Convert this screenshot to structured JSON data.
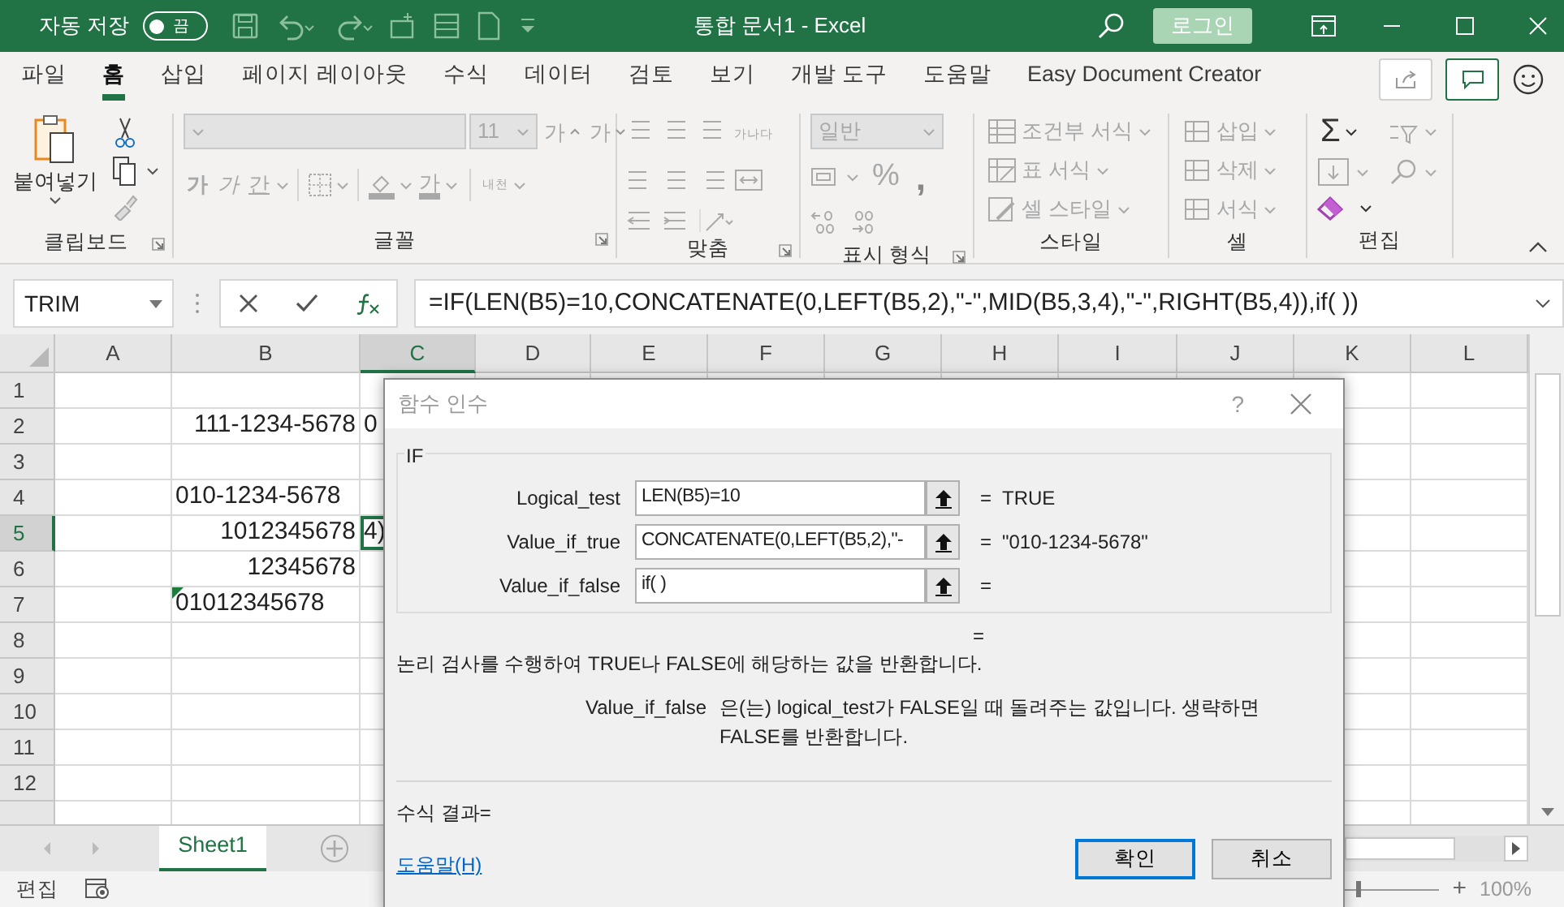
{
  "title_bar": {
    "autosave_label": "자동 저장",
    "autosave_toggle": {
      "text": "끔",
      "on": false
    },
    "title": "통합 문서1  -  Excel",
    "login": "로그인"
  },
  "menu_tabs": [
    {
      "label": "파일",
      "selected": false
    },
    {
      "label": "홈",
      "selected": true
    },
    {
      "label": "삽입",
      "selected": false
    },
    {
      "label": "페이지 레이아웃",
      "selected": false
    },
    {
      "label": "수식",
      "selected": false
    },
    {
      "label": "데이터",
      "selected": false
    },
    {
      "label": "검토",
      "selected": false
    },
    {
      "label": "보기",
      "selected": false
    },
    {
      "label": "개발 도구",
      "selected": false
    },
    {
      "label": "도움말",
      "selected": false
    },
    {
      "label": "Easy Document Creator",
      "selected": false
    }
  ],
  "ribbon": {
    "groups": [
      {
        "kind": "clipboard",
        "label": "클립보드",
        "disabled": false,
        "paste": "붙여넣기"
      },
      {
        "kind": "font",
        "label": "글꼴",
        "disabled": true,
        "size": "11",
        "grow": "가",
        "shrink": "가",
        "bold": "가",
        "italic": "가",
        "underline": "간",
        "font_color": "가",
        "phonetic": "내천"
      },
      {
        "kind": "alignment",
        "label": "맞춤",
        "disabled": true,
        "wrap": "가나다"
      },
      {
        "kind": "number",
        "label": "표시 형식",
        "disabled": true,
        "format": "일반",
        "percent": "%",
        "comma": ","
      },
      {
        "kind": "styles",
        "label": "스타일",
        "disabled": true,
        "items": [
          "조건부 서식",
          "표 서식",
          "셀 스타일"
        ]
      },
      {
        "kind": "cells",
        "label": "셀",
        "disabled": true,
        "items": [
          "삽입",
          "삭제",
          "서식"
        ]
      },
      {
        "kind": "editing",
        "label": "편집",
        "disabled": false,
        "sum": "Σ"
      }
    ]
  },
  "formula_bar": {
    "name_box": "TRIM",
    "formula": "=IF(LEN(B5)=10,CONCATENATE(0,LEFT(B5,2),\"-\",MID(B5,3,4),\"-\",RIGHT(B5,4)),if( ))"
  },
  "grid": {
    "columns": [
      {
        "label": "A",
        "selected": false
      },
      {
        "label": "B",
        "selected": false
      },
      {
        "label": "C",
        "selected": true
      },
      {
        "label": "D",
        "selected": false
      },
      {
        "label": "E",
        "selected": false
      },
      {
        "label": "F",
        "selected": false
      },
      {
        "label": "G",
        "selected": false
      },
      {
        "label": "H",
        "selected": false
      },
      {
        "label": "I",
        "selected": false
      },
      {
        "label": "J",
        "selected": false
      },
      {
        "label": "K",
        "selected": false
      },
      {
        "label": "L",
        "selected": false
      }
    ],
    "rows": [
      {
        "header": "1",
        "selected": false
      },
      {
        "header": "2",
        "selected": false,
        "cells": [
          "",
          {
            "text": "111-1234-5678",
            "kind": "number",
            "error": false
          },
          {
            "text": "0",
            "kind": "text",
            "error": false
          }
        ]
      },
      {
        "header": "3",
        "selected": false
      },
      {
        "header": "4",
        "selected": false,
        "cells": [
          "",
          {
            "text": "010-1234-5678",
            "kind": "text",
            "error": false
          }
        ]
      },
      {
        "header": "5",
        "selected": true,
        "cells": [
          "",
          {
            "text": "1012345678",
            "kind": "number",
            "error": false
          },
          {
            "text": "4)",
            "kind": "text",
            "error": false
          }
        ]
      },
      {
        "header": "6",
        "selected": false,
        "cells": [
          "",
          {
            "text": "12345678",
            "kind": "number",
            "error": false
          }
        ]
      },
      {
        "header": "7",
        "selected": false,
        "cells": [
          "",
          {
            "text": "01012345678",
            "kind": "text",
            "error": true
          }
        ]
      },
      {
        "header": "8",
        "selected": false
      },
      {
        "header": "9",
        "selected": false
      },
      {
        "header": "10",
        "selected": false
      },
      {
        "header": "11",
        "selected": false
      },
      {
        "header": "12",
        "selected": false
      },
      {
        "selected": false
      }
    ]
  },
  "sheet_tabs": [
    {
      "label": "Sheet1",
      "selected": true
    }
  ],
  "status_bar": {
    "mode": "편집",
    "zoom_slider": {
      "level": 0.5
    },
    "zoom_in": "+",
    "zoom": "100%"
  },
  "dialog": {
    "title": "함수 인수",
    "help": "?",
    "function": "IF",
    "args": [
      {
        "name": "Logical_test",
        "value": "LEN(B5)=10",
        "equals": "=",
        "result": "TRUE"
      },
      {
        "name": "Value_if_true",
        "value": "CONCATENATE(0,LEFT(B5,2),\"-",
        "equals": "=",
        "result": "\"010-1234-5678\""
      },
      {
        "name": "Value_if_false",
        "value": "if( )",
        "equals": "="
      }
    ],
    "formula_equals": "=",
    "description": "논리 검사를 수행하여 TRUE나 FALSE에 해당하는 값을 반환합니다.",
    "arg_name": "Value_if_false",
    "arg_description": "은(는) logical_test가 FALSE일 때 돌려주는 값입니다. 생략하면 FALSE를 반환합니다.",
    "result_label": "수식 결과=",
    "help_link": "도움말(H)",
    "buttons": [
      {
        "label": "확인",
        "selected": true
      },
      {
        "label": "취소",
        "selected": false
      }
    ]
  }
}
